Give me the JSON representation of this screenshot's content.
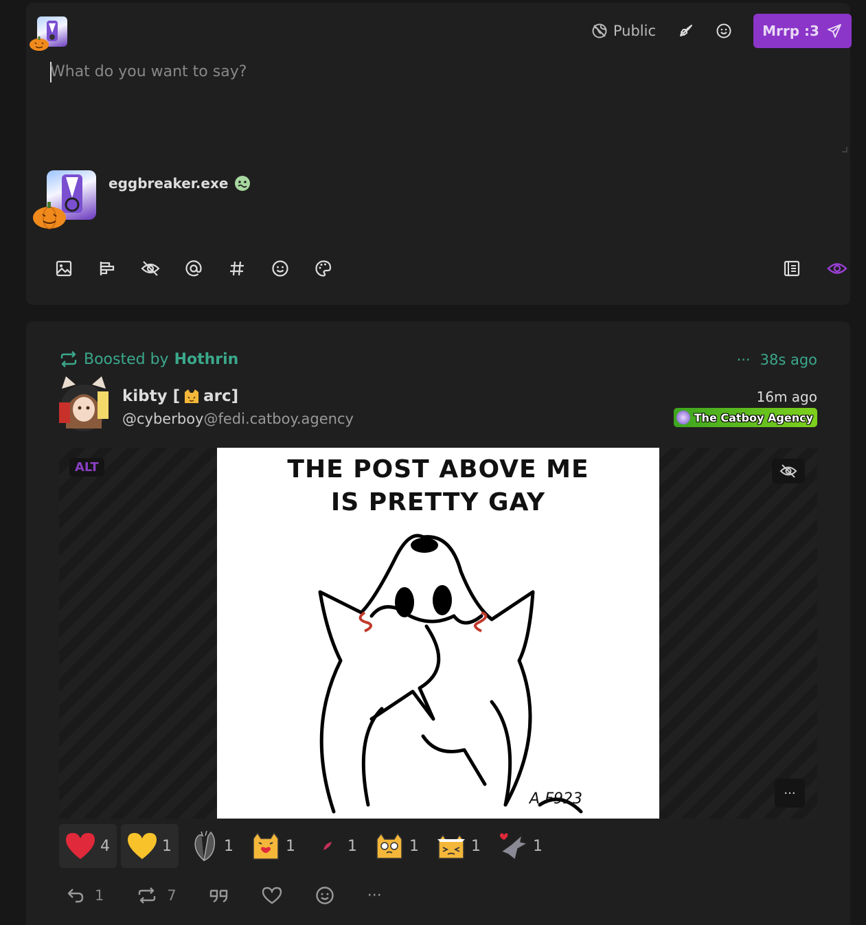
{
  "composer": {
    "visibility_label": "Public",
    "post_button_label": "Mrrp :3",
    "placeholder": "What do you want to say?",
    "preview_display_name": "eggbreaker.exe"
  },
  "post": {
    "boosted_prefix": "Boosted by",
    "booster_name": "Hothrin",
    "boost_time": "38s ago",
    "author_name_part1": "kibty [",
    "author_name_part2": " arc]",
    "author_handle_user": "@cyberboy",
    "author_handle_domain": "@fedi.catboy.agency",
    "post_time": "16m ago",
    "instance_name": "The Catboy Agency",
    "media": {
      "alt_label": "ALT",
      "caption_line1": "THE POST ABOVE ME",
      "caption_line2": "IS PRETTY GAY",
      "signature": "A.F923"
    },
    "reactions": [
      {
        "emoji": "red-heart",
        "count": "4"
      },
      {
        "emoji": "yellow-heart",
        "count": "1"
      },
      {
        "emoji": "anatomical-heart",
        "count": "1"
      },
      {
        "emoji": "cat-hug-heart",
        "count": "1"
      },
      {
        "emoji": "small-feather",
        "count": "1"
      },
      {
        "emoji": "cat-pleading",
        "count": "1"
      },
      {
        "emoji": "cat-squint",
        "count": "1"
      },
      {
        "emoji": "dragon-heart",
        "count": "1"
      }
    ],
    "reply_count": "1",
    "boost_count": "7"
  },
  "colors": {
    "accent": "#8b35c9",
    "boost_green": "#3ba88b",
    "background": "#171717",
    "card": "#1f1f1f"
  }
}
